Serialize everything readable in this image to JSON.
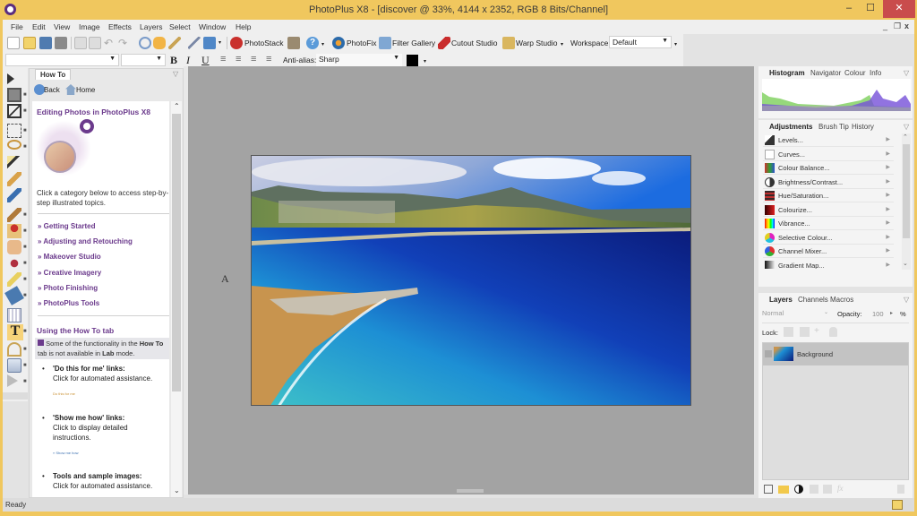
{
  "window": {
    "title": "PhotoPlus X8 - [discover @ 33%, 4144 x 2352, RGB 8 Bits/Channel]",
    "minimize": "–",
    "maximize": "☐",
    "close": "✕"
  },
  "menu": [
    "File",
    "Edit",
    "View",
    "Image",
    "Effects",
    "Layers",
    "Select",
    "Window",
    "Help"
  ],
  "mdi_controls": {
    "min": "_",
    "restore": "❐",
    "close": "x"
  },
  "toolbar": {
    "photostack": "PhotoStack",
    "photofix": "PhotoFix",
    "filter_gallery": "Filter Gallery",
    "cutout_studio": "Cutout Studio",
    "warp_studio": "Warp Studio",
    "workspace_label": "Workspace",
    "workspace_value": "Default"
  },
  "text_toolbar": {
    "font": "",
    "size": "",
    "bold": "B",
    "italic": "I",
    "underline": "U",
    "antialias_label": "Anti-alias:",
    "antialias_value": "Sharp",
    "color": "#000000"
  },
  "howto": {
    "tab": "How To",
    "back": "Back",
    "home": "Home",
    "heading": "Editing Photos in PhotoPlus X8",
    "intro": "Click a category below to access step-by-step illustrated topics.",
    "categories": [
      "Getting Started",
      "Adjusting and Retouching",
      "Makeover Studio",
      "Creative Imagery",
      "Photo Finishing",
      "PhotoPlus Tools"
    ],
    "using_heading": "Using the How To tab",
    "note_parts": [
      "Some of the functionality in the ",
      "How To",
      " tab is not available in ",
      "Lab",
      " mode."
    ],
    "bullets": [
      {
        "title": "'Do this for me' links:",
        "text": "Click for automated assistance.",
        "sample": "Do this for me"
      },
      {
        "title": "'Show me how' links:",
        "text": "Click to display detailed instructions.",
        "sample": "» Show me how"
      },
      {
        "title": "Tools and sample images:",
        "text": "Click for automated assistance.",
        "sample": ""
      }
    ]
  },
  "right_panels": {
    "top_tabs": [
      "Histogram",
      "Navigator",
      "Colour",
      "Info"
    ],
    "adj_tabs": [
      "Adjustments",
      "Brush Tip",
      "History"
    ],
    "adjustments": [
      "Levels...",
      "Curves...",
      "Colour Balance...",
      "Brightness/Contrast...",
      "Hue/Saturation...",
      "Colourize...",
      "Vibrance...",
      "Selective Colour...",
      "Channel Mixer...",
      "Gradient Map..."
    ],
    "layer_tabs": [
      "Layers",
      "Channels",
      "Macros"
    ],
    "blend_mode": "Normal",
    "opacity_label": "Opacity:",
    "opacity_value": "100",
    "opacity_unit": "%",
    "lock_label": "Lock:",
    "layers": [
      {
        "name": "Background"
      }
    ]
  },
  "status": {
    "text": "Ready"
  },
  "canvas": {
    "cursor_glyph": "A"
  }
}
